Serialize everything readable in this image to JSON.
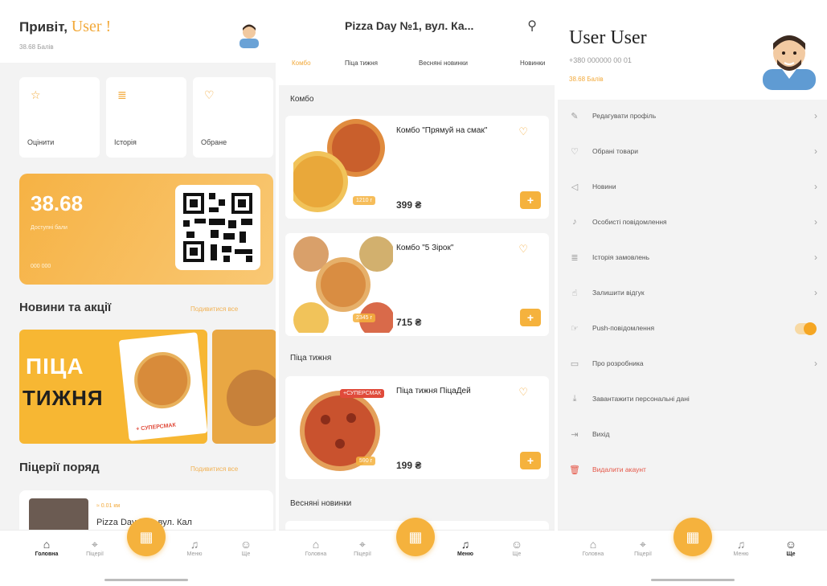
{
  "home": {
    "greeting": "Привіт,",
    "user": "User !",
    "points_small": "38.68 Балів",
    "quick": [
      {
        "label": "Оцінити",
        "icon": "star-icon"
      },
      {
        "label": "Історія",
        "icon": "list-icon"
      },
      {
        "label": "Обране",
        "icon": "heart-icon"
      }
    ],
    "bonus_value": "38.68",
    "bonus_label": "Доступні бали",
    "bonus_sub": "000 000",
    "news_title": "Новини та акції",
    "see_all": "Подивитися все",
    "promo_line1": "ПІЦА",
    "promo_line2": "ТИЖНЯ",
    "promo_badge": "+ СУПЕРСМАК",
    "pizzerias_title": "Піцерії поряд",
    "pizzeria_name": "Pizza Day №1, вул. Кал",
    "pizzeria_dist": "≈ 0.01 км"
  },
  "menu": {
    "title": "Pizza Day №1, вул. Ка...",
    "tabs": [
      "Комбо",
      "Піца тижня",
      "Весняні новинки",
      "Новинки"
    ],
    "cat_combo": "Комбо",
    "cat_week": "Піца тижня",
    "cat_spring": "Весняні новинки",
    "products": [
      {
        "name": "Комбо \"Прямуй на смак\"",
        "price": "399 ₴",
        "tag": "1210 г"
      },
      {
        "name": "Комбо \"5 Зірок\"",
        "price": "715 ₴",
        "tag": "2345 г"
      },
      {
        "name": "Піца тижня ПіцаДей",
        "price": "199 ₴",
        "tag": "590 г"
      }
    ],
    "super_badge": "+СУПЕРСМАК"
  },
  "profile": {
    "name": "User User",
    "phone": "+380 000000 00 01",
    "points": "38.68 Балів",
    "rows": [
      {
        "label": "Редагувати профіль",
        "icon": "pencil-icon",
        "type": "chevron"
      },
      {
        "label": "Обрані товари",
        "icon": "heart-icon",
        "type": "chevron"
      },
      {
        "label": "Новини",
        "icon": "megaphone-icon",
        "type": "chevron"
      },
      {
        "label": "Особисті повідомлення",
        "icon": "bell-icon",
        "type": "chevron"
      },
      {
        "label": "Історія замовлень",
        "icon": "list-icon",
        "type": "chevron"
      },
      {
        "label": "Залишити відгук",
        "icon": "thumbs-up-icon",
        "type": "chevron"
      },
      {
        "label": "Push-повідомлення",
        "icon": "tap-icon",
        "type": "toggle"
      },
      {
        "label": "Про розробника",
        "icon": "card-icon",
        "type": "chevron"
      },
      {
        "label": "Завантажити персональні дані",
        "icon": "download-icon",
        "type": "none"
      },
      {
        "label": "Вихід",
        "icon": "logout-icon",
        "type": "none"
      },
      {
        "label": "Видалити акаунт",
        "icon": "trash-icon",
        "type": "danger"
      }
    ]
  },
  "nav": {
    "home": "Головна",
    "pizzerias": "Піцерії",
    "menu": "Меню",
    "me": "Ще"
  },
  "colors": {
    "accent": "#f5b23d",
    "danger": "#e55546"
  }
}
